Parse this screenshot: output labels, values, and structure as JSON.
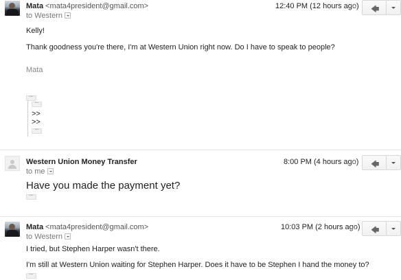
{
  "messages": [
    {
      "sender_name": "Mata",
      "sender_email": "<mata4president@gmail.com>",
      "recipient": "to Western",
      "time": "12:40 PM (12 hours ago)",
      "avatar": "user-photo",
      "greeting": "Kelly!",
      "body": "Thank goodness you're there, I'm at Western Union right now. Do I have to speak to people?",
      "signature": "Mata",
      "quote_lines": [
        ">>",
        ">>"
      ]
    },
    {
      "sender_name": "Western Union Money Transfer",
      "recipient": "to me",
      "time": "8:00 PM (4 hours ago)",
      "avatar": "default-avatar",
      "body": "Have you made the payment yet?"
    },
    {
      "sender_name": "Mata",
      "sender_email": "<mata4president@gmail.com>",
      "recipient": "to Western",
      "time": "10:03 PM (2 hours ago)",
      "avatar": "user-photo",
      "line1": "I tried, but Stephen Harper wasn't there.",
      "line2": "I'm still at Western Union waiting for Stephen Harper. Does it have to be Stephen I hand the money to?"
    }
  ],
  "icons": {
    "star": "star-icon",
    "reply": "reply-icon",
    "more": "chevron-down-icon",
    "show_trimmed": "ellipsis-icon"
  },
  "symbols": {
    "star": "☆",
    "reply": "🡄",
    "ellipsis": "···"
  },
  "colors": {
    "divider": "#e5e5e5",
    "meta_text": "#777777",
    "star": "#d6d6d6"
  }
}
